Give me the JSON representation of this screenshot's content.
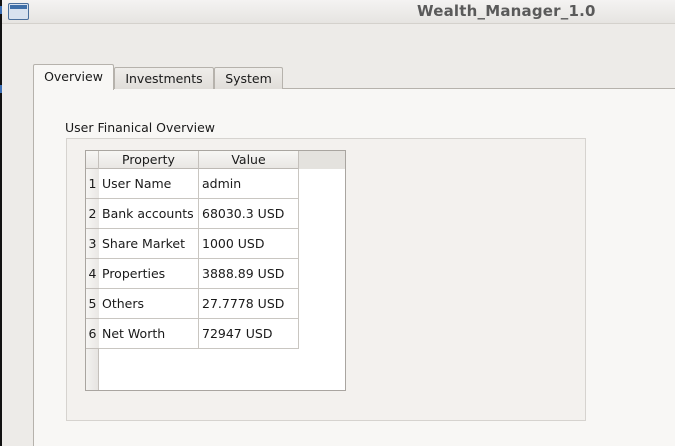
{
  "window": {
    "title": "Wealth_Manager_1.0"
  },
  "tabs": [
    {
      "label": "Overview",
      "active": true
    },
    {
      "label": "Investments",
      "active": false
    },
    {
      "label": "System",
      "active": false
    }
  ],
  "overview": {
    "group_title": "User Finanical Overview",
    "table": {
      "headers": [
        "Property",
        "Value"
      ],
      "rows": [
        {
          "index": "1",
          "property": "User Name",
          "value": "admin"
        },
        {
          "index": "2",
          "property": "Bank accounts",
          "value": "68030.3 USD"
        },
        {
          "index": "3",
          "property": "Share Market",
          "value": "1000 USD"
        },
        {
          "index": "4",
          "property": "Properties",
          "value": "3888.89 USD"
        },
        {
          "index": "5",
          "property": "Others",
          "value": "27.7778 USD"
        },
        {
          "index": "6",
          "property": "Net Worth",
          "value": "72947 USD"
        }
      ]
    }
  },
  "colors": {
    "window_bg": "#edebe8",
    "panel_bg": "#f8f7f5",
    "title_text": "#5a5a5a",
    "icon_blue": "#3f6fa8"
  },
  "icons": {
    "app": "app-window-icon"
  }
}
